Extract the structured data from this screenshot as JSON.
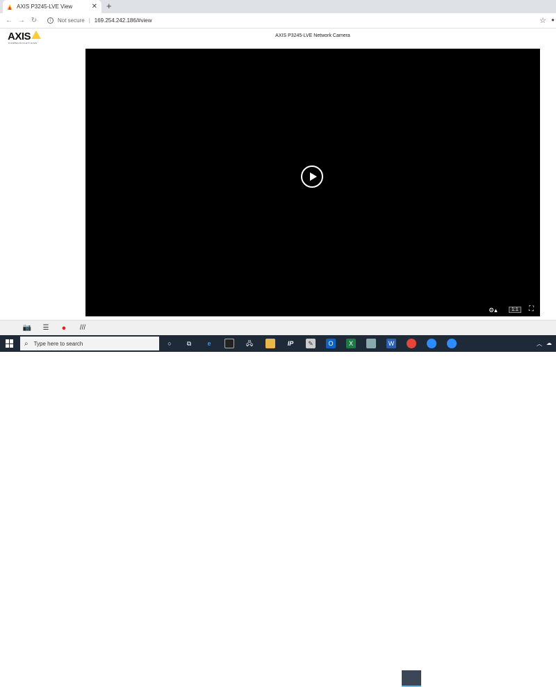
{
  "browser": {
    "tab_title": "AXIS P3245-LVE View",
    "tab_close": "✕",
    "new_tab": "+",
    "security_label": "Not secure",
    "url": "169.254.242.186/#view"
  },
  "page": {
    "logo_text": "AXIS",
    "logo_subtext": "COMMUNICATIONS",
    "title": "AXIS P3245-LVE Network Camera"
  },
  "video": {
    "aspect_ratio_label": "1:1"
  },
  "taskbar": {
    "search_placeholder": "Type here to search",
    "ip_app_label": "IP"
  },
  "colors": {
    "accent_yellow": "#ffcc33",
    "record_red": "#e02020",
    "taskbar_bg": "#1f2a38"
  }
}
